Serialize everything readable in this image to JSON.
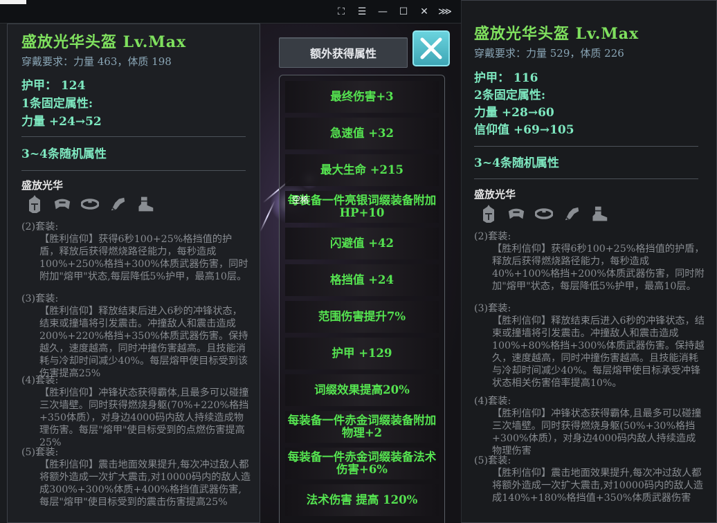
{
  "window": {
    "controls": [
      "⛶",
      "☰",
      "—",
      "☐",
      "✕",
      "⋙"
    ]
  },
  "left_item": {
    "name": "盛放光华头盔 Lv.Max",
    "requirement": "穿戴要求：力量 463，体质 198",
    "armor": "护甲：  124",
    "fixed_count": "1条固定属性:",
    "fixed_stats": [
      "力量  +24→52"
    ],
    "random_header": "3~4条随机属性",
    "set_name": "盛放光华",
    "bonuses": [
      {
        "label": "(2)套装:",
        "text": "【胜利信仰】获得6秒100+25%格挡值的护盾，释放后获得燃烧路径能力，每秒造成100%+250%格挡+300%体质武器伤害，同时附加\"熔甲\"状态,每层降低5%护甲，最高10层。"
      },
      {
        "label": "(3)套装:",
        "text": "【胜利信仰】释放结束后进入6秒的冲锋状态，结束或撞墙将引发震击。冲撞敌人和震击造成200%+220%格挡+350%体质武器伤害。保持越久，速度越高，同时冲撞伤害越高。且技能消耗与冷却时间减少40%。每层熔甲使目标受到该伤害提高25%"
      },
      {
        "label": "(4)套装:",
        "text": "【胜利信仰】冲锋状态获得霸体,且最多可以碰撞三次墙壁。同时获得燃烧身躯(70%+220%格挡+350体质），对身边4000码内敌人持续造成物理伤害。每层\"熔甲\"使目标受到的点燃伤害提高25%"
      },
      {
        "label": "(5)套装:",
        "text": "【胜利信仰】震击地面效果提升,每次冲过敌人都将额外造成一次扩大震击,对10000码内的敌人造成300%+300%体质+400%格挡值武器伤害,每层\"熔甲\"使目标受到的震击伤害提高25%"
      }
    ]
  },
  "right_item": {
    "name": "盛放光华头盔 Lv.Max",
    "requirement": "穿戴要求：力量 529，体质 226",
    "armor": "护甲：  116",
    "fixed_count": "2条固定属性:",
    "fixed_stats": [
      "力量  +28→60",
      "信仰值  +69→105"
    ],
    "random_header": "3~4条随机属性",
    "set_name": "盛放光华",
    "bonuses": [
      {
        "label": "(2)套装:",
        "text": "【胜利信仰】获得6秒100+25%格挡值的护盾，释放后获得燃烧路径能力，每秒造成40%+100%格挡+200%体质武器伤害，同时附加\"熔甲\"状态，每层降低5%护甲，最高10层。"
      },
      {
        "label": "(3)套装:",
        "text": "【胜利信仰】释放结束后进入6秒的冲锋状态，结束或撞墙将引发震击。冲撞敌人和震击造成100%+80%格挡+300%体质武器伤害。保持越久，速度越高，同时冲撞伤害越高。且技能消耗与冷却时间减少40%。每层熔甲使目标承受冲锋状态相关伤害倍率提高10%。"
      },
      {
        "label": "(4)套装:",
        "text": "【胜利信仰】冲锋状态获得霸体,且最多可以碰撞三次墙壁。同时获得燃烧身躯(50%+30%格挡+300%体质），对身边4000码内敌人持续造成物理伤害"
      },
      {
        "label": "(5)套装:",
        "text": "【胜利信仰】震击地面效果提升,每次冲过敌人都将额外造成一次扩大震击,对10000码内的敌人造成140%+180%格挡值+350%体质武器伤害"
      }
    ]
  },
  "extra_panel": {
    "button_label": "额外获得属性",
    "tooltip": "空格",
    "attributes": [
      "最终伤害+3",
      "急速值  +32",
      "最大生命  +215",
      "每装备一件亮银词缀装备附加HP+10",
      "闪避值  +42",
      "格挡值  +24",
      "范围伤害提升7%",
      "护甲  +129",
      "词缀效果提高20%",
      "每装备一件赤金词缀装备附加物理+2",
      "每装备一件赤金词缀装备法术伤害+6%",
      "法术伤害  提高  120%"
    ]
  },
  "colors": {
    "item_name": "#7fe05e",
    "stat": "#7ee8c0",
    "attribute": "#55e350",
    "close_button": "#4fbcc8"
  }
}
